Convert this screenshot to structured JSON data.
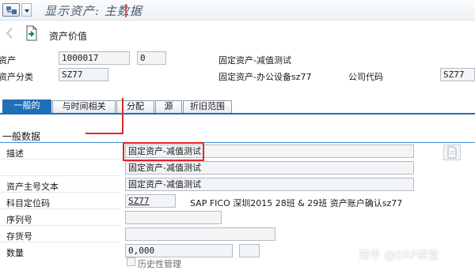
{
  "window": {
    "title": "显示资产: 主数据"
  },
  "toolbar": {
    "asset_values_label": "资产价值"
  },
  "header": {
    "asset_label": "资产",
    "asset_number": "1000017",
    "sub_number": "0",
    "asset_description": "固定资产-减值测试",
    "class_label": "资产分类",
    "class_value": "SZ77",
    "class_description": "固定资产-办公设备sz77",
    "company_label": "公司代码",
    "company_value": "SZ77"
  },
  "tabs": [
    {
      "label": "一般的",
      "active": true
    },
    {
      "label": "与时间相关",
      "active": false
    },
    {
      "label": "分配",
      "active": false
    },
    {
      "label": "源",
      "active": false
    },
    {
      "label": "折旧范围",
      "active": false
    }
  ],
  "general": {
    "group_title": "一般数据",
    "description_label": "描述",
    "description_1": "固定资产-减值测试",
    "description_2": "固定资产-减值测试",
    "main_text_label": "资产主号文本",
    "main_text_value": "固定资产-减值测试",
    "account_label": "科目定位码",
    "account_value": "SZ77",
    "account_text": "SAP FICO 深圳2015 28班 & 29班 资产账户确认sz77",
    "serial_label": "序列号",
    "inventory_label": "存货号",
    "quantity_label": "数量",
    "quantity_value": "0,000",
    "history_label": "历史性管理"
  },
  "watermark": "知乎 @ERP讲堂",
  "colors": {
    "tab_active": "#1f6fb8",
    "annotation": "#e02626"
  }
}
